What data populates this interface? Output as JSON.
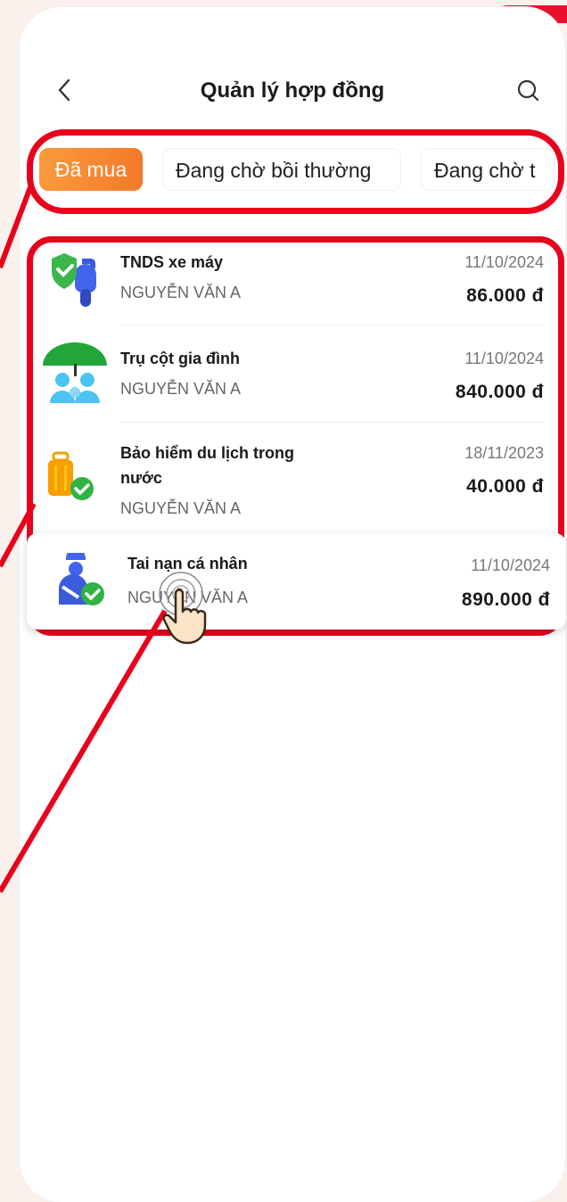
{
  "header": {
    "title": "Quản lý hợp đồng"
  },
  "tabs": [
    {
      "label": "Đã mua",
      "active": true
    },
    {
      "label": "Đang chờ bồi thường",
      "active": false
    },
    {
      "label": "Đang chờ t",
      "active": false
    }
  ],
  "contracts": [
    {
      "name": "TNDS xe máy",
      "holder": "NGUYỄN VĂN A",
      "date": "11/10/2024",
      "price": "86.000 đ",
      "icon": "motorbike-insurance-icon"
    },
    {
      "name": "Trụ cột gia đình",
      "holder": "NGUYỄN VĂN A",
      "date": "11/10/2024",
      "price": "840.000 đ",
      "icon": "family-umbrella-icon"
    },
    {
      "name_line1": "Bảo hiểm du lịch trong",
      "name_line2": "nước",
      "holder": "NGUYỄN VĂN A",
      "date": "18/11/2023",
      "price": "40.000 đ",
      "icon": "travel-luggage-icon"
    },
    {
      "name": "Tai nạn cá nhân",
      "holder": "NGUYỄN VĂN A",
      "date": "11/10/2024",
      "price": "890.000 đ",
      "icon": "personal-accident-icon"
    }
  ],
  "colors": {
    "accent": "#f37a2b",
    "annotation": "#e8001c",
    "brand_red": "#e8102e"
  }
}
